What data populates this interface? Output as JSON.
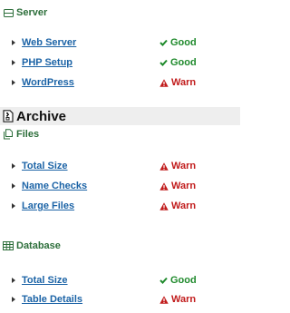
{
  "server": {
    "title": "Server",
    "icon": "server-icon",
    "items": [
      {
        "label": "Web Server",
        "status": "Good",
        "state": "good"
      },
      {
        "label": "PHP Setup",
        "status": "Good",
        "state": "good"
      },
      {
        "label": "WordPress",
        "status": "Warn",
        "state": "warn"
      }
    ]
  },
  "archive": {
    "title": "Archive",
    "icon": "archive-icon"
  },
  "files": {
    "title": "Files",
    "icon": "files-icon",
    "items": [
      {
        "label": "Total Size",
        "status": "Warn",
        "state": "warn"
      },
      {
        "label": "Name Checks",
        "status": "Warn",
        "state": "warn"
      },
      {
        "label": "Large Files",
        "status": "Warn",
        "state": "warn"
      }
    ]
  },
  "database": {
    "title": "Database",
    "icon": "database-icon",
    "items": [
      {
        "label": "Total Size",
        "status": "Good",
        "state": "good"
      },
      {
        "label": "Table Details",
        "status": "Warn",
        "state": "warn"
      }
    ]
  },
  "colors": {
    "link": "#1b63a6",
    "good": "#1f8a2c",
    "warn": "#c11b1b",
    "section": "#2c6e3a"
  }
}
